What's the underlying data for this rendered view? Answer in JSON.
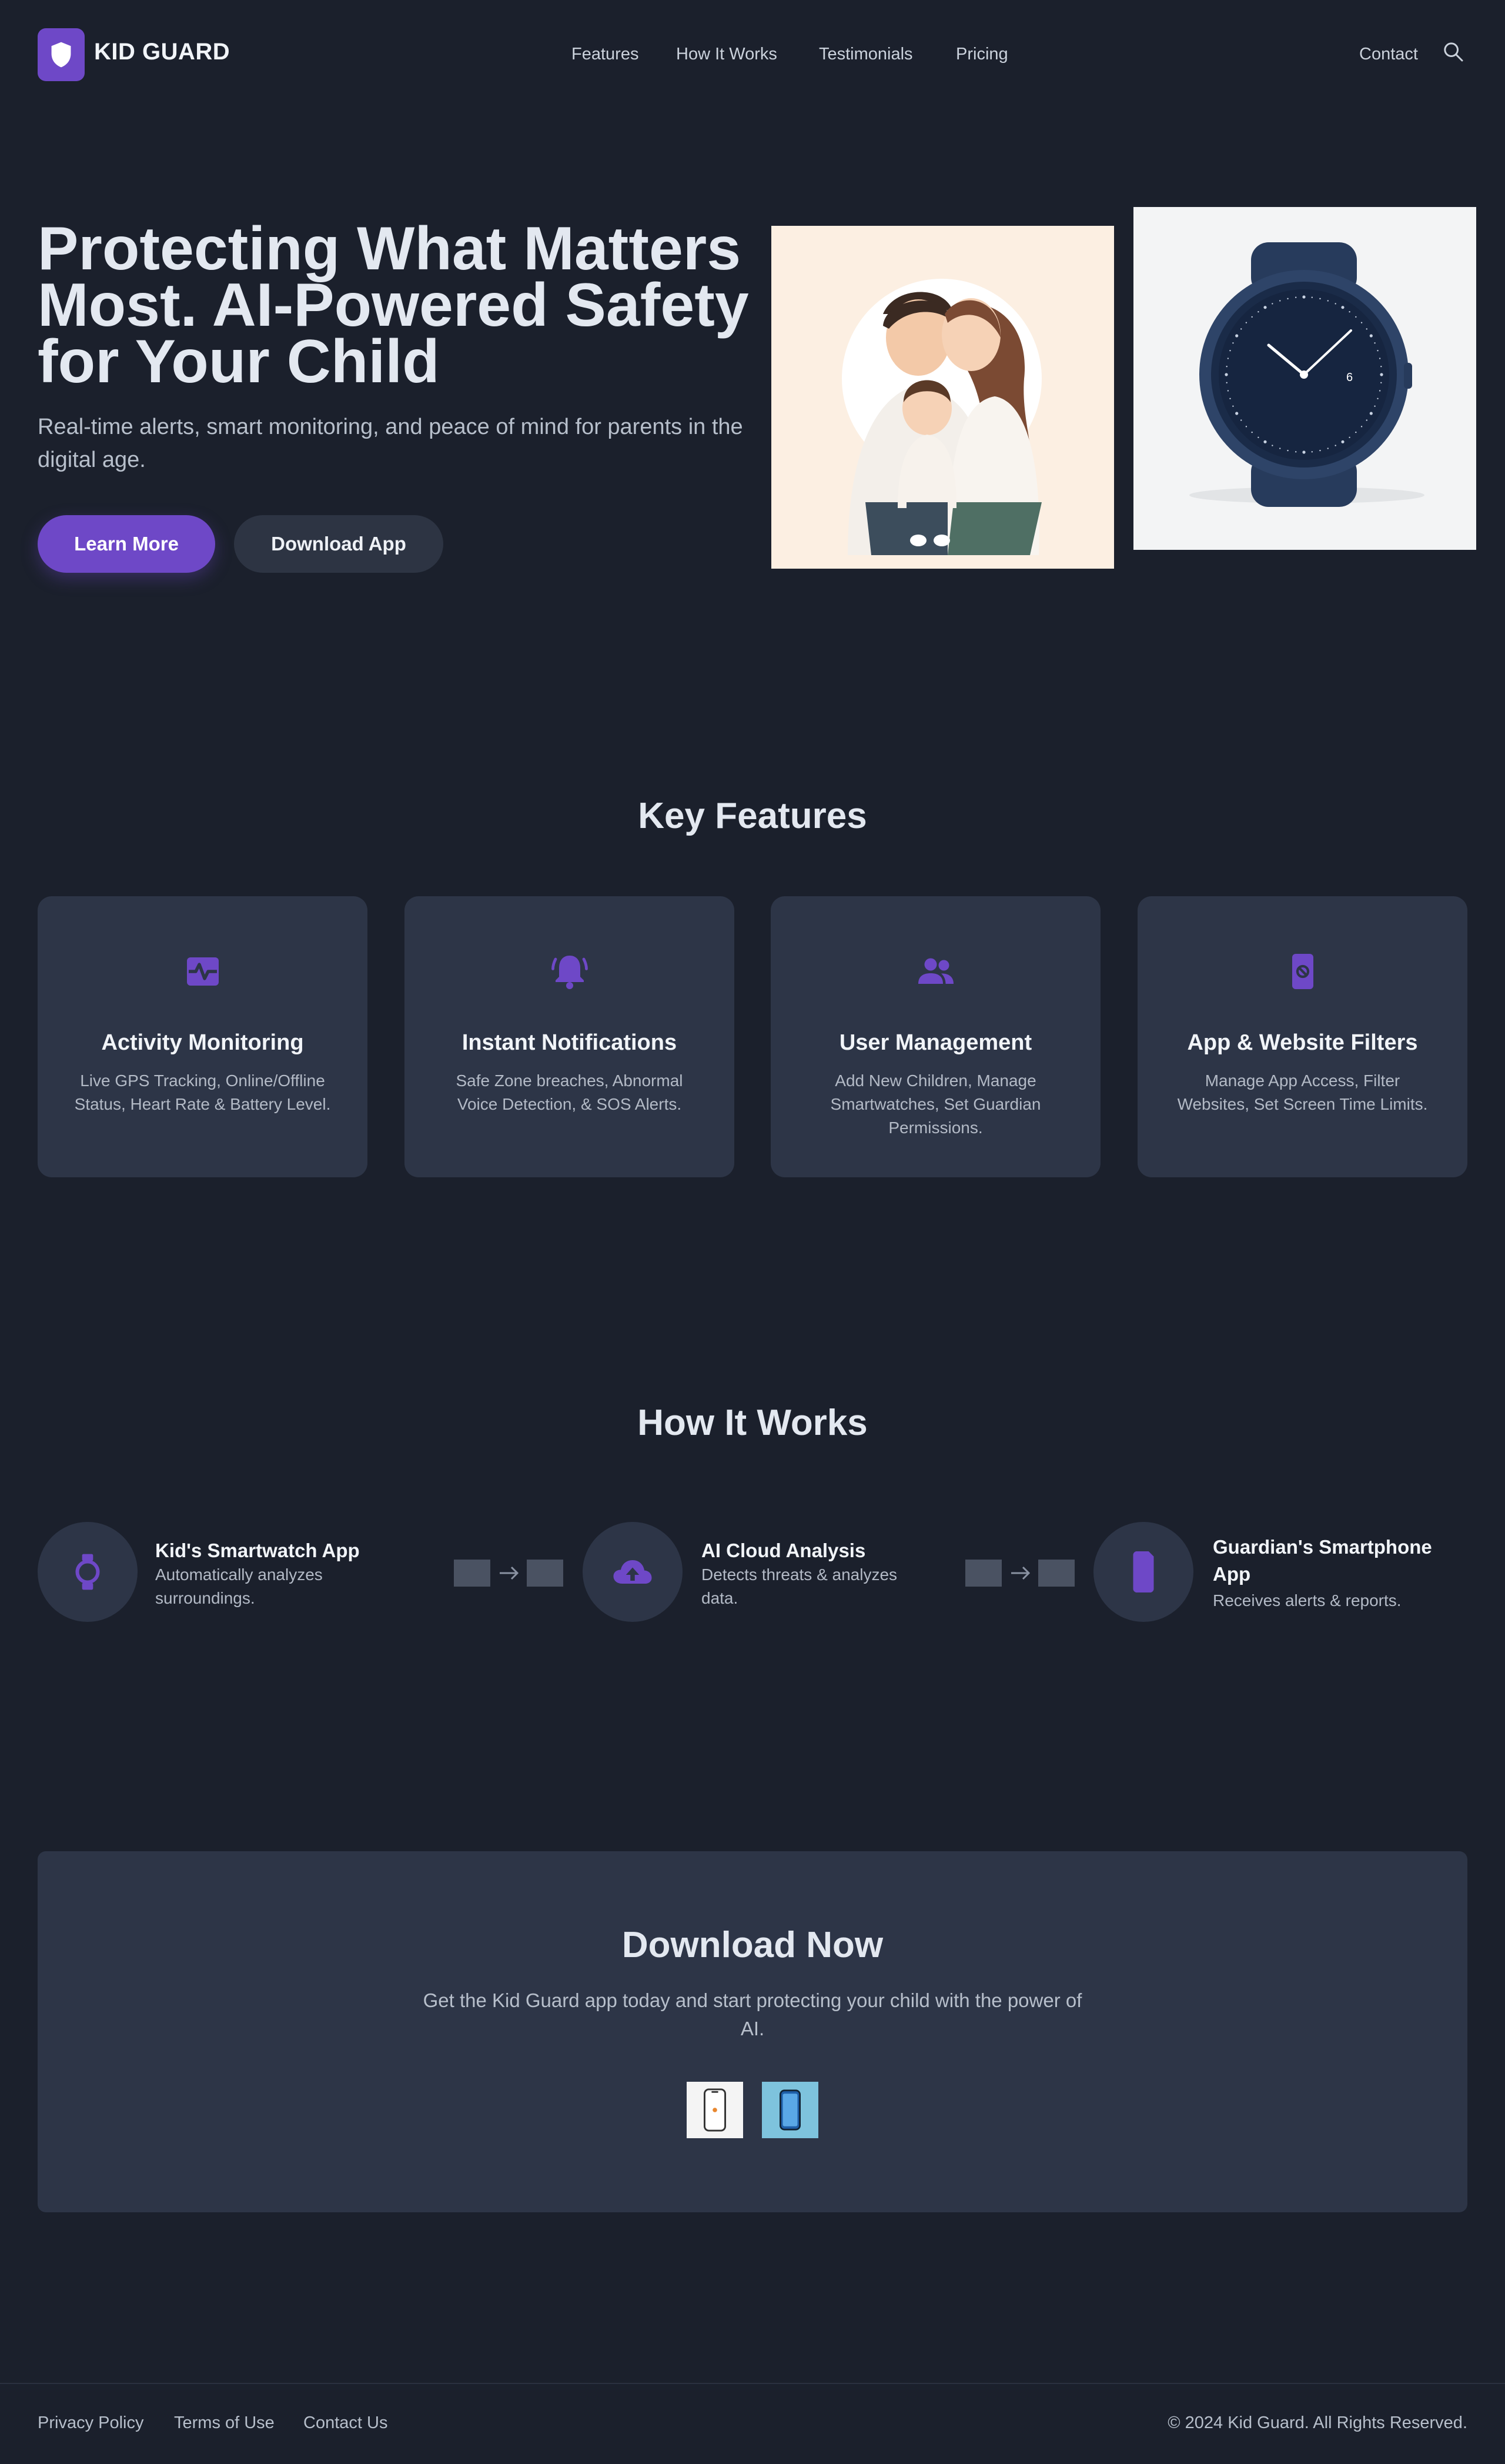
{
  "header": {
    "brand": "KID GUARD",
    "nav": [
      "Features",
      "How It Works",
      "Testimonials",
      "Pricing"
    ],
    "contact": "Contact"
  },
  "hero": {
    "title": "Protecting What Matters Most. AI-Powered Safety for Your Child",
    "subtitle": "Real-time alerts, smart monitoring, and peace of mind for parents in the digital age.",
    "primary_button": "Learn More",
    "secondary_button": "Download App"
  },
  "features": {
    "title": "Key Features",
    "cards": [
      {
        "icon": "heart-monitor-icon",
        "title": "Activity Monitoring",
        "desc": "Live GPS Tracking, Online/Offline Status, Heart Rate & Battery Level."
      },
      {
        "icon": "bell-alert-icon",
        "title": "Instant Notifications",
        "desc": "Safe Zone breaches, Abnormal Voice Detection, & SOS Alerts."
      },
      {
        "icon": "users-icon",
        "title": "User Management",
        "desc": "Add New Children, Manage Smartwatches, Set Guardian Permissions."
      },
      {
        "icon": "phone-block-icon",
        "title": "App & Website Filters",
        "desc": "Manage App Access, Filter Websites, Set Screen Time Limits."
      }
    ]
  },
  "how": {
    "title": "How It Works",
    "steps": [
      {
        "icon": "watch-icon",
        "title": "Kid's Smartwatch App",
        "desc": "Automatically analyzes surroundings."
      },
      {
        "icon": "cloud-upload-icon",
        "title": "AI Cloud Analysis",
        "desc": "Detects threats & analyzes data."
      },
      {
        "icon": "smartphone-icon",
        "title": "Guardian's Smartphone App",
        "desc": "Receives alerts & reports."
      }
    ]
  },
  "download": {
    "title": "Download Now",
    "subtitle": "Get the Kid Guard app today and start protecting your child with the power of AI."
  },
  "footer": {
    "links": [
      "Privacy Policy",
      "Terms of Use",
      "Contact Us"
    ],
    "copyright": "© 2024 Kid Guard. All Rights Reserved."
  },
  "colors": {
    "background": "#1b202c",
    "card": "#2d3547",
    "accent": "#6e48c7"
  }
}
